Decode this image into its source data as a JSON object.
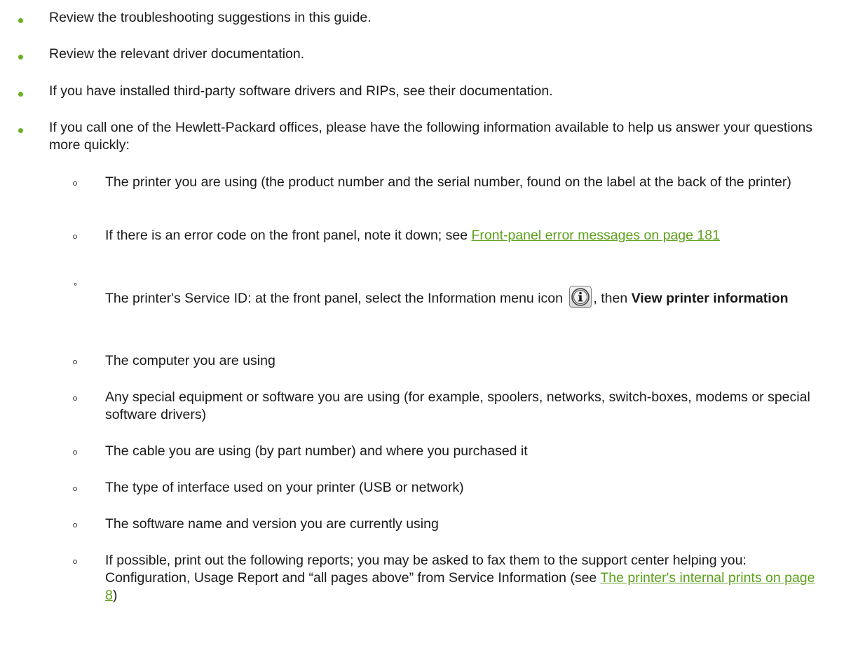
{
  "colors": {
    "accent_green": "#6ab023",
    "link_green": "#5ca01a",
    "text": "#1a1a1a"
  },
  "list": {
    "items": [
      {
        "text": "Review the troubleshooting suggestions in this guide."
      },
      {
        "text": "Review the relevant driver documentation."
      },
      {
        "text": "If you have installed third-party software drivers and RIPs, see their documentation."
      },
      {
        "text": "If you call one of the Hewlett-Packard offices, please have the following information available to help us answer your questions more quickly:"
      }
    ],
    "subitems": {
      "printer": "The printer you are using (the product number and the serial number, found on the label at the back of the printer)",
      "error_code_prefix": "If there is an error code on the front panel, note it down; see ",
      "error_code_link": "Front-panel error messages on page 181",
      "service_id_prefix": "The printer's Service ID: at the front panel, select the Information menu icon ",
      "service_id_middle": ", then ",
      "service_id_bold": "View printer information",
      "info_icon": "information-icon",
      "computer": "The computer you are using",
      "equipment": "Any special equipment or software you are using (for example, spoolers, networks, switch-boxes, modems or special software drivers)",
      "cable": "The cable you are using (by part number) and where you purchased it",
      "interface": "The type of interface used on your printer (USB or network)",
      "software": "The software name and version you are currently using",
      "reports_prefix": "If possible, print out the following reports; you may be asked to fax them to the support center helping you: Configuration, Usage Report and “all pages above” from Service Information (see ",
      "reports_link": "The printer's internal prints on page 8",
      "reports_suffix": ")"
    }
  }
}
